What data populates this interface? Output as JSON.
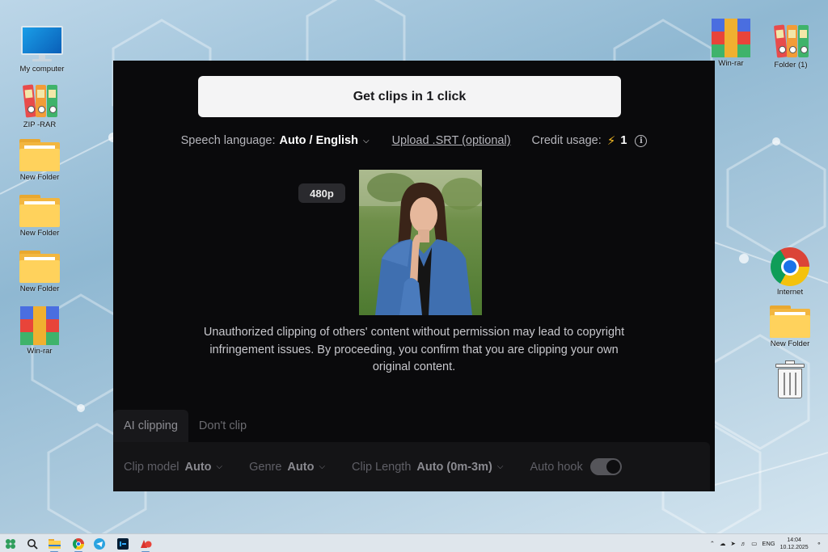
{
  "desktop": {
    "left_icons": [
      {
        "label": "My computer"
      },
      {
        "label": "ZIP -RAR"
      },
      {
        "label": "New Folder"
      },
      {
        "label": "New Folder"
      },
      {
        "label": "New Folder"
      },
      {
        "label": "Win-rar"
      }
    ],
    "right_icons": [
      {
        "label": "Win-rar"
      },
      {
        "label": "Folder (1)"
      },
      {
        "label": "Internet"
      },
      {
        "label": "New Folder"
      },
      {
        "label": "Recycle bin"
      }
    ]
  },
  "app": {
    "cta_label": "Get clips in 1 click",
    "speech_language_label": "Speech language:",
    "speech_language_value": "Auto / English",
    "upload_srt_label": "Upload .SRT (optional)",
    "credit_usage_label": "Credit usage:",
    "credit_usage_value": "1",
    "info_glyph": "i",
    "resolution_badge": "480p",
    "disclaimer_line1": "Unauthorized clipping of others' content without permission may lead to copyright",
    "disclaimer_line2": "infringement issues. By proceeding, you confirm that you are clipping your own",
    "disclaimer_line3": "original content.",
    "tabs": [
      {
        "label": "AI clipping",
        "active": true
      },
      {
        "label": "Don't clip",
        "active": false
      }
    ],
    "settings": {
      "clip_model_label": "Clip model",
      "clip_model_value": "Auto",
      "genre_label": "Genre",
      "genre_value": "Auto",
      "clip_length_label": "Clip Length",
      "clip_length_value": "Auto (0m-3m)",
      "auto_hook_label": "Auto hook",
      "auto_hook_on": true
    }
  },
  "taskbar": {
    "language": "ENG",
    "time": "14:04",
    "date": "10.12.2025"
  },
  "colors": {
    "app_background": "#0a0a0c",
    "cta_background": "#f4f4f5",
    "bolt": "#fbbf24"
  }
}
